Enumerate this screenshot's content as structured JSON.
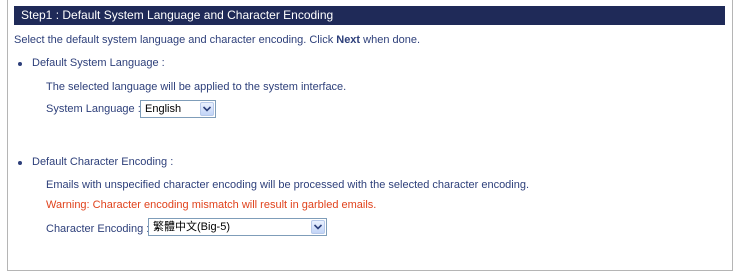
{
  "step": {
    "title": "Step1 : Default System Language and Character Encoding"
  },
  "intro": {
    "before": "Select the default system language and character encoding. Click ",
    "bold": "Next",
    "after": " when done."
  },
  "language": {
    "heading": "Default System Language :",
    "description": "The selected language will be applied to the system interface.",
    "label": "System Language :",
    "selected": "English"
  },
  "encoding": {
    "heading": "Default Character Encoding :",
    "description": "Emails with unspecified character encoding will be processed with the selected character encoding.",
    "warning": "Warning: Character encoding mismatch will result in garbled emails.",
    "label": "Character Encoding :",
    "selected": "繁體中文(Big-5)"
  },
  "icons": {
    "dropdown": "chevron-down-icon",
    "bullet": "bullet-icon"
  },
  "colors": {
    "header_bg": "#1f2a58",
    "text": "#2d3f7a",
    "warning": "#e0421c"
  }
}
